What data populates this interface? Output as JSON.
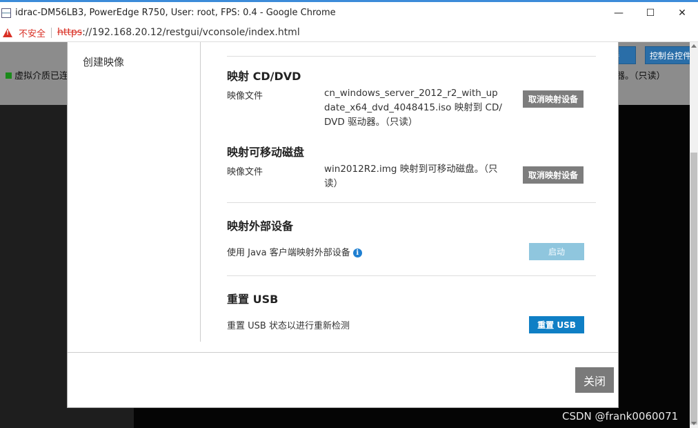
{
  "browser": {
    "title": "idrac-DM56LB3, PowerEdge R750, User: root, FPS: 0.4 - Google Chrome",
    "security_label": "不安全",
    "url_scheme": "https",
    "url_rest": "://192.168.20.12/restgui/vconsole/index.html",
    "minimize": "—",
    "maximize": "☐",
    "close": "✕"
  },
  "background_app": {
    "status_text": "虚拟介质已连",
    "right_text": "动器。（只读）",
    "btn_connect": "连接",
    "btn_console": "控制台控件"
  },
  "modal": {
    "sidebar_item": "创建映像",
    "cd": {
      "title": "映射 CD/DVD",
      "label": "映像文件",
      "value": "cn_windows_server_2012_r2_with_update_x64_dvd_4048415.iso 映射到 CD/DVD 驱动器。（只读）",
      "button": "取消映射设备"
    },
    "removable": {
      "title": "映射可移动磁盘",
      "label": "映像文件",
      "value": "win2012R2.img 映射到可移动磁盘。（只读）",
      "button": "取消映射设备"
    },
    "external": {
      "title": "映射外部设备",
      "label": "使用 Java 客户端映射外部设备",
      "info": "i",
      "button": "启动"
    },
    "usb": {
      "title": "重置 USB",
      "label": "重置 USB 状态以进行重新检测",
      "button": "重置 USB"
    },
    "close_button": "关闭"
  },
  "watermark": "CSDN @frank0060071",
  "colors": {
    "primary_button": "#0f7fc5",
    "gray_button": "#7d7d7d",
    "disabled_button": "#8fc6de",
    "insecure_red": "#d93025"
  }
}
